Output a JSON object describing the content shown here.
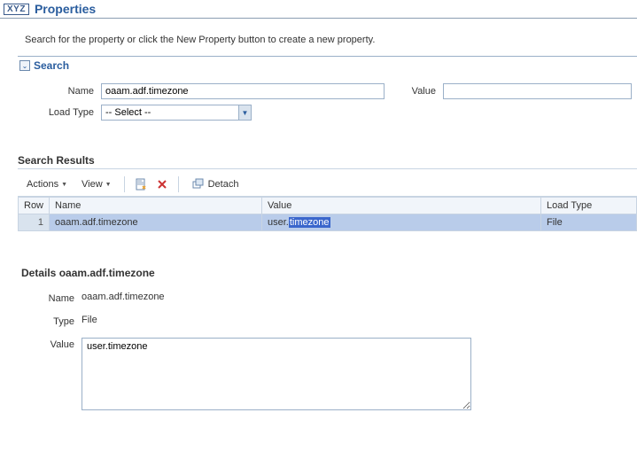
{
  "header": {
    "brand": "XYZ",
    "title": "Properties"
  },
  "instruction": "Search for the property or click the New Property button to create a new property.",
  "search": {
    "panel_title": "Search",
    "name_label": "Name",
    "name_value": "oaam.adf.timezone",
    "value_label": "Value",
    "value_value": "",
    "loadtype_label": "Load Type",
    "loadtype_selected": "-- Select --"
  },
  "results": {
    "section_title": "Search Results",
    "toolbar": {
      "actions_label": "Actions",
      "view_label": "View",
      "detach_label": "Detach"
    },
    "columns": {
      "row": "Row",
      "name": "Name",
      "value": "Value",
      "loadtype": "Load Type"
    },
    "rows": [
      {
        "num": "1",
        "name": "oaam.adf.timezone",
        "value_prefix": "user.",
        "value_highlight": "timezone",
        "loadtype": "File"
      }
    ]
  },
  "details": {
    "title_prefix": "Details",
    "title_subject": "oaam.adf.timezone",
    "name_label": "Name",
    "name_value": "oaam.adf.timezone",
    "type_label": "Type",
    "type_value": "File",
    "value_label": "Value",
    "value_text": "user.timezone"
  }
}
